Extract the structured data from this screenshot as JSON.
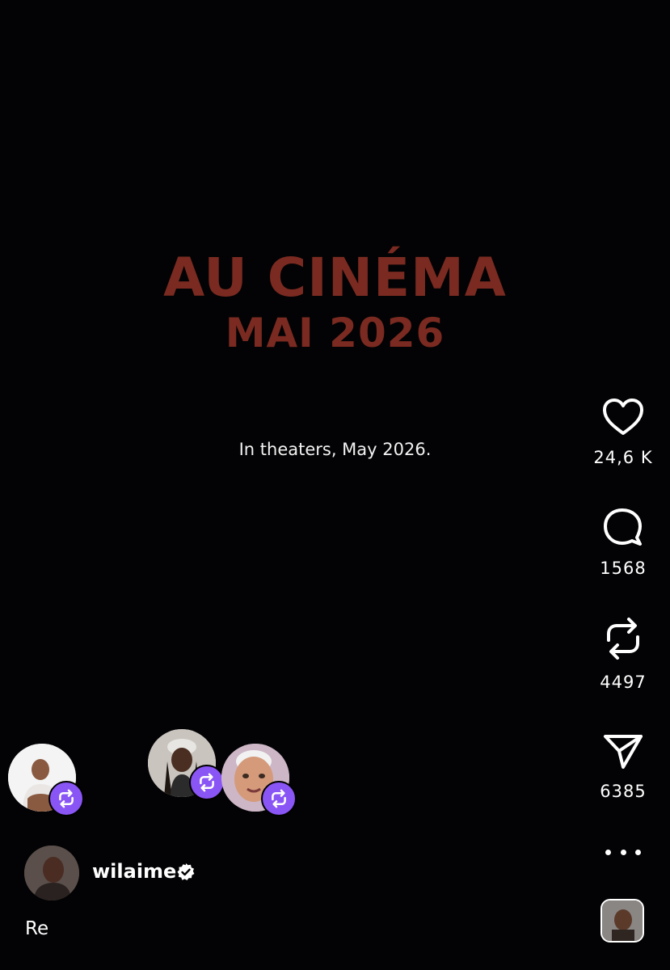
{
  "video": {
    "headline_line1": "AU CINÉMA",
    "headline_line2": "MAI 2026",
    "subtitle": "In theaters, May 2026.",
    "headline_color": "#7a2a20"
  },
  "actions": {
    "like": {
      "icon": "heart-icon",
      "count": "24,6 K"
    },
    "comment": {
      "icon": "comment-bubble-icon",
      "count": "1568"
    },
    "repost": {
      "icon": "repost-icon",
      "count": "4497"
    },
    "share": {
      "icon": "paper-plane-icon",
      "count": "6385"
    },
    "more": {
      "icon": "more-dots-icon"
    }
  },
  "reposters": {
    "badge_color": "#8a55f5",
    "badge_icon": "repost-icon"
  },
  "author": {
    "username": "wilaime",
    "verified_icon": "verified-badge-icon"
  },
  "caption": "Re"
}
